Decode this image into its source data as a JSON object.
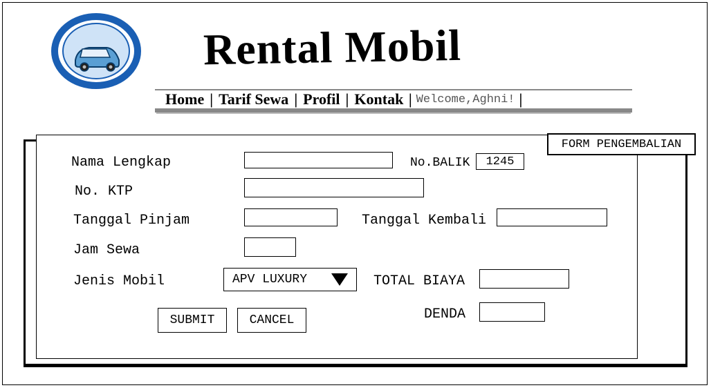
{
  "header": {
    "title": "Rental Mobil"
  },
  "nav": {
    "items": [
      "Home",
      "Tarif Sewa",
      "Profil",
      "Kontak"
    ],
    "welcome": "Welcome,Aghni!"
  },
  "form": {
    "badge": "FORM PENGEMBALIAN",
    "labels": {
      "nama_lengkap": "Nama Lengkap",
      "no_ktp": "No. KTP",
      "tanggal_pinjam": "Tanggal Pinjam",
      "jam_sewa": "Jam Sewa",
      "jenis_mobil": "Jenis Mobil",
      "no_balik": "No.BALIK",
      "tanggal_kembali": "Tanggal Kembali",
      "total_biaya": "TOTAL BIAYA",
      "denda": "DENDA"
    },
    "values": {
      "nama_lengkap": "",
      "no_ktp": "",
      "tanggal_pinjam": "",
      "jam_sewa": "",
      "jenis_mobil": "APV LUXURY",
      "no_balik": "1245",
      "tanggal_kembali": "",
      "total_biaya": "",
      "denda": ""
    },
    "buttons": {
      "submit": "SUBMIT",
      "cancel": "CANCEL"
    }
  }
}
